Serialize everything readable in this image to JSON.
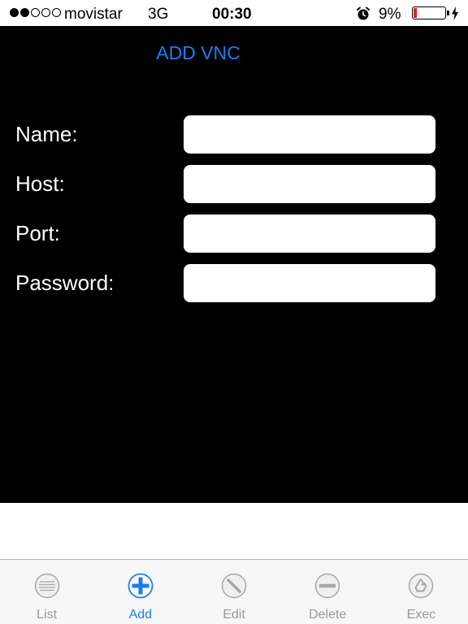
{
  "status_bar": {
    "signal_filled": 2,
    "signal_total": 5,
    "carrier": "movistar",
    "network": "3G",
    "time": "00:30",
    "battery_percent": "9%",
    "battery_level": 0.09,
    "battery_color": "#e0201b"
  },
  "form": {
    "title": "ADD VNC",
    "fields": [
      {
        "label": "Name:",
        "value": "",
        "placeholder": ""
      },
      {
        "label": "Host:",
        "value": "",
        "placeholder": ""
      },
      {
        "label": "Port:",
        "value": "",
        "placeholder": ""
      },
      {
        "label": "Password:",
        "value": "",
        "placeholder": ""
      }
    ]
  },
  "tab_bar": {
    "active": "Add",
    "accent_color": "#1a7ef0",
    "tabs": [
      {
        "label": "List",
        "icon": "list-icon"
      },
      {
        "label": "Add",
        "icon": "plus-icon"
      },
      {
        "label": "Edit",
        "icon": "pencil-icon"
      },
      {
        "label": "Delete",
        "icon": "minus-icon"
      },
      {
        "label": "Exec",
        "icon": "recycle-icon"
      }
    ]
  }
}
